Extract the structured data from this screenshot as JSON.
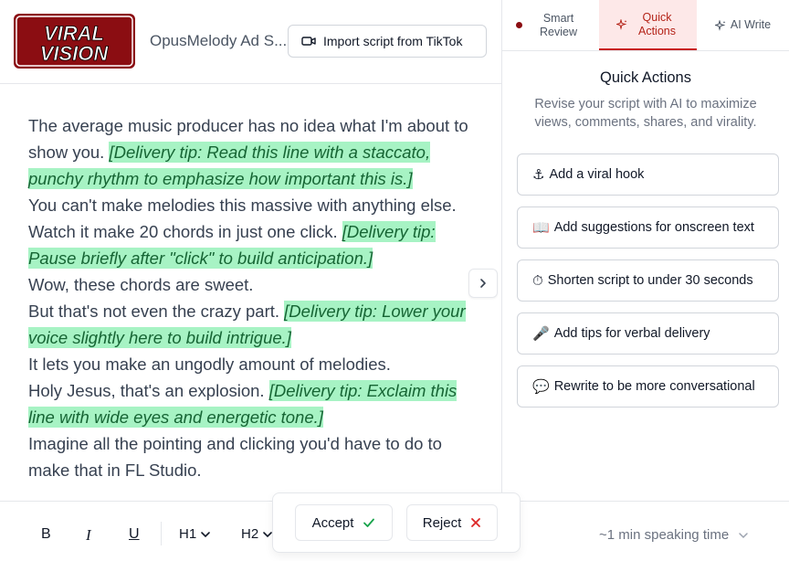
{
  "brand": {
    "logo_text": "VIRAL VISION",
    "color": "#8b0d12"
  },
  "header": {
    "doc_title": "OpusMelody Ad S...",
    "import_label": "Import script from TikTok"
  },
  "script": [
    {
      "text": "The average music producer has no idea what I'm about to show you.",
      "tip": "[Delivery tip: Read this line with a staccato, punchy rhythm to emphasize how important this is.]"
    },
    {
      "text": "You can't make melodies this massive with anything else.",
      "tip": ""
    },
    {
      "text": "Watch it make 20 chords in just one click.",
      "tip": "[Delivery tip: Pause briefly after \"click\" to build anticipation.]"
    },
    {
      "text": "Wow, these chords are sweet.",
      "tip": ""
    },
    {
      "text": "But that's not even the crazy part.",
      "tip": "[Delivery tip: Lower your voice slightly here to build intrigue.]"
    },
    {
      "text": "It lets you make an ungodly amount of melodies.",
      "tip": ""
    },
    {
      "text": "Holy Jesus, that's an explosion.",
      "tip": "[Delivery tip: Exclaim this line with wide eyes and energetic tone.]"
    },
    {
      "text": "Imagine all the pointing and clicking you'd have to do to make that in FL Studio.",
      "tip": ""
    }
  ],
  "tabs": [
    {
      "label": "Smart Review",
      "icon": "record-dot-icon"
    },
    {
      "label": "Quick Actions",
      "icon": "sparkle-icon"
    },
    {
      "label": "AI Write",
      "icon": "sparkle-icon"
    }
  ],
  "panel": {
    "title": "Quick Actions",
    "subtitle": "Revise your script with AI to maximize views, comments, shares, and virality.",
    "actions": [
      {
        "emoji": "⚓",
        "label": "Add a viral hook",
        "icon": "anchor-icon"
      },
      {
        "emoji": "📖",
        "label": "Add suggestions for onscreen text",
        "icon": "book-icon"
      },
      {
        "emoji": "⏱",
        "label": "Shorten script to under 30 seconds",
        "icon": "stopwatch-icon"
      },
      {
        "emoji": "🎤",
        "label": "Add tips for verbal delivery",
        "icon": "microphone-icon"
      },
      {
        "emoji": "💬",
        "label": "Rewrite to be more conversational",
        "icon": "speech-bubble-icon"
      }
    ]
  },
  "toolbar": {
    "bold": "B",
    "italic": "I",
    "underline": "U",
    "h1": "H1",
    "h2": "H2",
    "speaking_time": "~1 min speaking time"
  },
  "review_popup": {
    "accept": "Accept",
    "reject": "Reject",
    "accept_color": "#16a34a",
    "reject_color": "#dc2626"
  },
  "colors": {
    "tip_bg": "#a7f3c4",
    "tip_text": "#166534",
    "active_tab_bg": "#fde8e8",
    "active_tab_text": "#b42318"
  }
}
